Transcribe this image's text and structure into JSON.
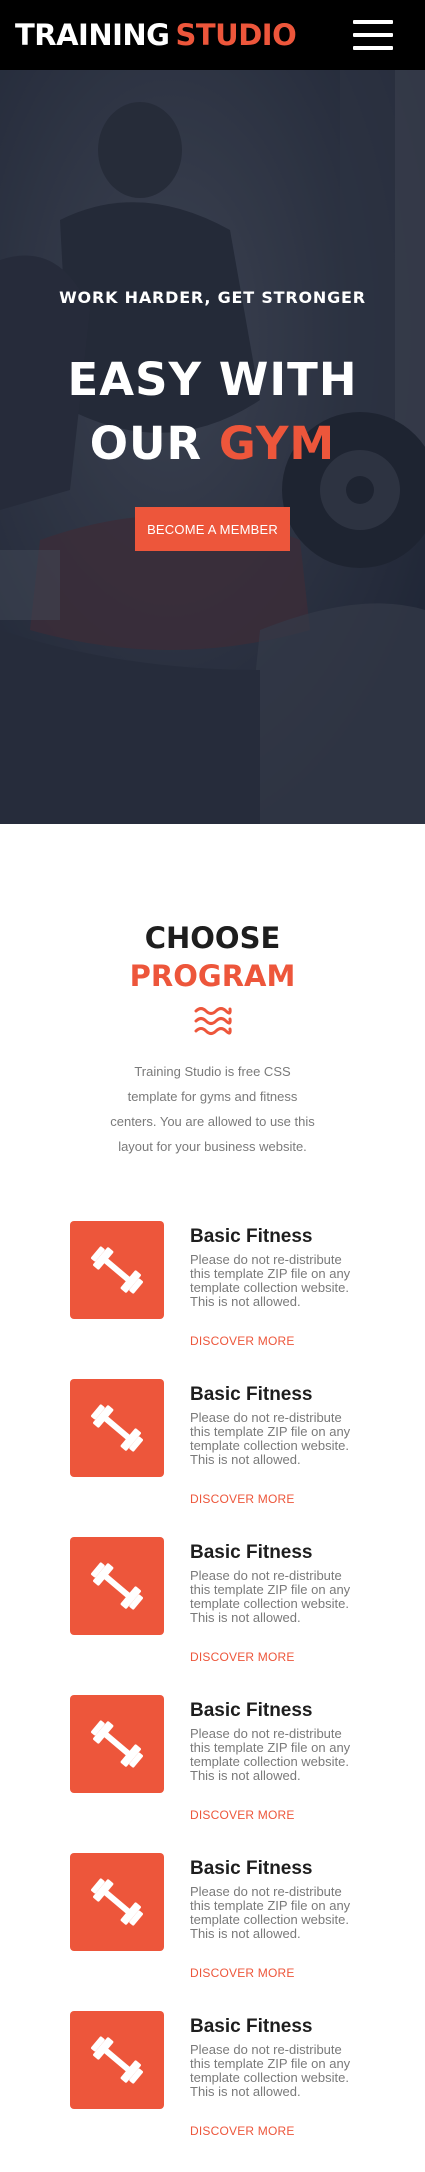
{
  "header": {
    "logo_main": "TRAINING",
    "logo_accent": "STUDIO",
    "menu_icon": "hamburger-menu-icon"
  },
  "hero": {
    "subtitle": "WORK HARDER, GET STRONGER",
    "title_line1": "EASY WITH",
    "title_line2_part1": "OUR",
    "title_line2_accent": "GYM",
    "button_label": "BECOME A MEMBER"
  },
  "program": {
    "heading": "CHOOSE",
    "heading_accent": "PROGRAM",
    "divider_icon": "waves-icon",
    "description": "Training Studio is free CSS template for gyms and fitness centers. You are allowed to use this layout for your business website.",
    "features": [
      {
        "icon": "dumbbell-icon",
        "title": "Basic Fitness",
        "text": "Please do not re-distribute this template ZIP file on any template collection website. This is not allowed.",
        "link": "DISCOVER MORE"
      },
      {
        "icon": "dumbbell-icon",
        "title": "Basic Fitness",
        "text": "Please do not re-distribute this template ZIP file on any template collection website. This is not allowed.",
        "link": "DISCOVER MORE"
      },
      {
        "icon": "dumbbell-icon",
        "title": "Basic Fitness",
        "text": "Please do not re-distribute this template ZIP file on any template collection website. This is not allowed.",
        "link": "DISCOVER MORE"
      },
      {
        "icon": "dumbbell-icon",
        "title": "Basic Fitness",
        "text": "Please do not re-distribute this template ZIP file on any template collection website. This is not allowed.",
        "link": "DISCOVER MORE"
      },
      {
        "icon": "dumbbell-icon",
        "title": "Basic Fitness",
        "text": "Please do not re-distribute this template ZIP file on any template collection website. This is not allowed.",
        "link": "DISCOVER MORE"
      },
      {
        "icon": "dumbbell-icon",
        "title": "Basic Fitness",
        "text": "Please do not re-distribute this template ZIP file on any template collection website. This is not allowed.",
        "link": "DISCOVER MORE"
      }
    ]
  },
  "colors": {
    "accent": "#ed563b",
    "header_bg": "#000000",
    "text_dark": "#1e1e1e",
    "text_muted": "#7a7a7a"
  }
}
